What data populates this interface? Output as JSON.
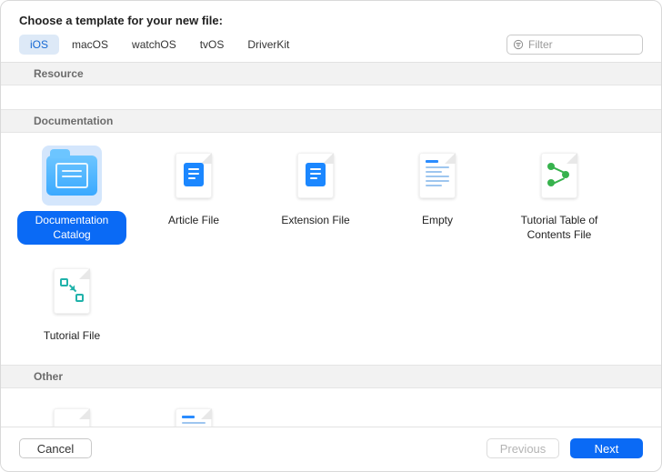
{
  "header": {
    "title": "Choose a template for your new file:"
  },
  "tabs": [
    {
      "label": "iOS",
      "active": true
    },
    {
      "label": "macOS",
      "active": false
    },
    {
      "label": "watchOS",
      "active": false
    },
    {
      "label": "tvOS",
      "active": false
    },
    {
      "label": "DriverKit",
      "active": false
    }
  ],
  "filter": {
    "placeholder": "Filter"
  },
  "groups": {
    "resource": {
      "title": "Resource"
    },
    "documentation": {
      "title": "Documentation",
      "items": [
        {
          "label": "Documentation Catalog",
          "icon": "folder-doc",
          "selected": true
        },
        {
          "label": "Article File",
          "icon": "article",
          "selected": false
        },
        {
          "label": "Extension File",
          "icon": "extension",
          "selected": false
        },
        {
          "label": "Empty",
          "icon": "empty",
          "selected": false
        },
        {
          "label": "Tutorial Table of Contents File",
          "icon": "toc",
          "selected": false
        },
        {
          "label": "Tutorial File",
          "icon": "tutorial",
          "selected": false
        }
      ]
    },
    "other": {
      "title": "Other"
    }
  },
  "footer": {
    "cancel": "Cancel",
    "previous": "Previous",
    "next": "Next"
  }
}
